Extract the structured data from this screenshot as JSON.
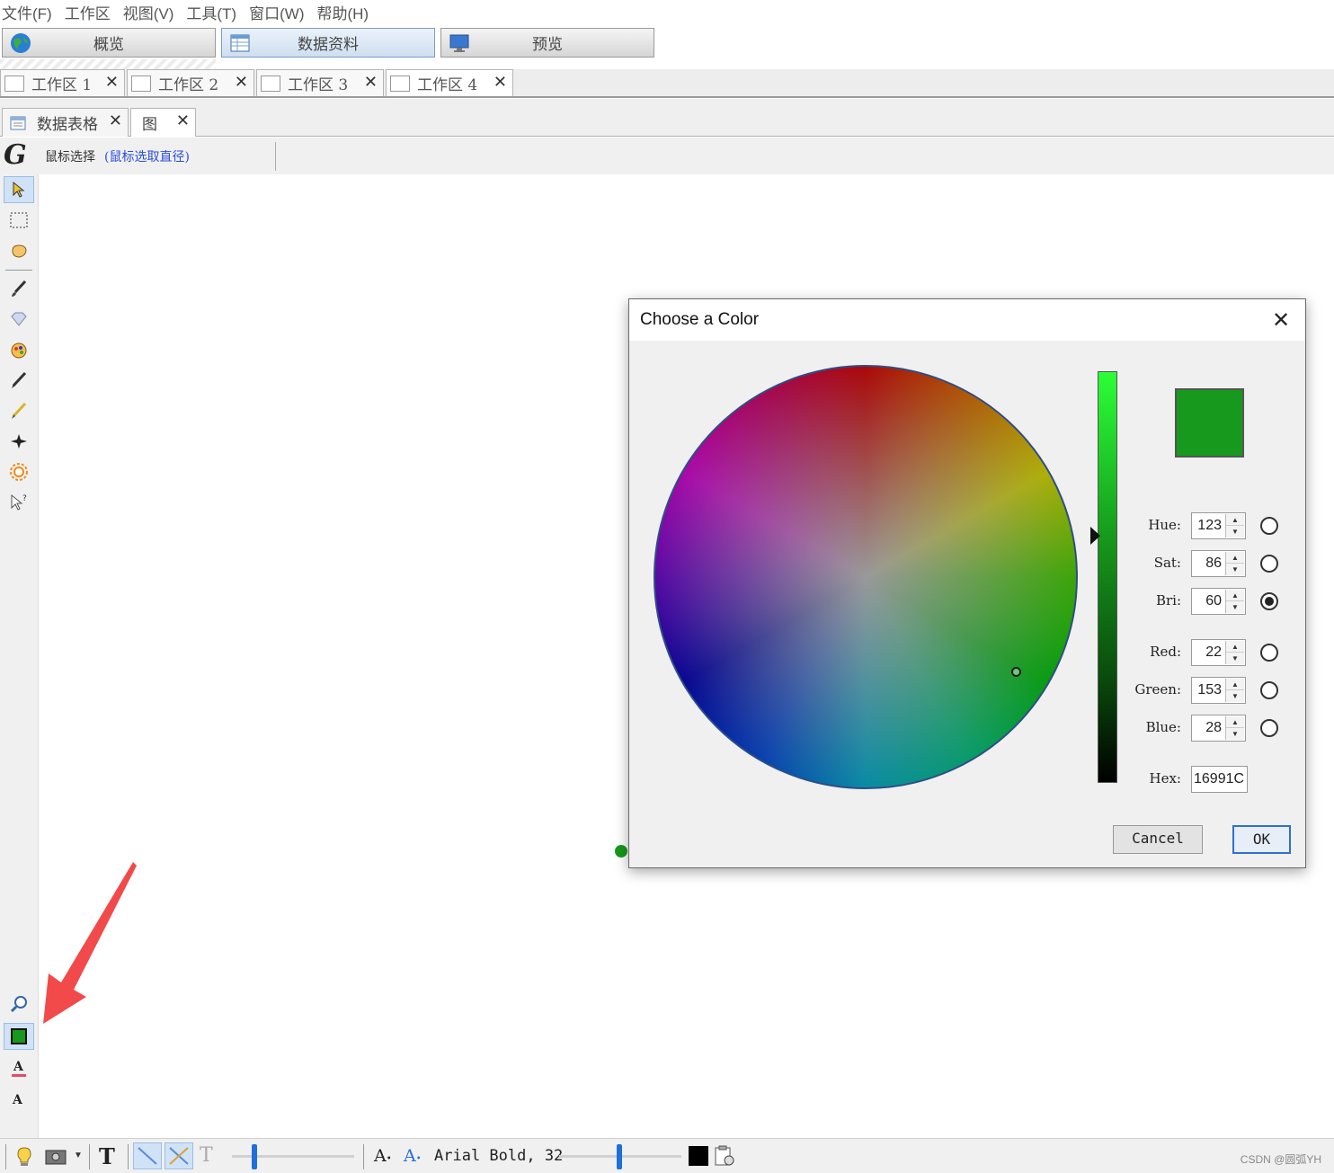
{
  "menu": [
    "文件(F)",
    "工作区",
    "视图(V)",
    "工具(T)",
    "窗口(W)",
    "帮助(H)"
  ],
  "nav": {
    "overview": "概览",
    "data": "数据资料",
    "preview": "预览"
  },
  "workspace_tabs": [
    "工作区 1",
    "工作区 2",
    "工作区 3",
    "工作区 4"
  ],
  "inner_tabs": [
    "数据表格",
    "图"
  ],
  "infobar": {
    "mode": "鼠标选择",
    "hint": "(鼠标选取直径)"
  },
  "bottom": {
    "font": "Arial Bold, 32",
    "credit": "CSDN @圆弧YH"
  },
  "dialog": {
    "title": "Choose a Color",
    "hue_label": "Hue:",
    "hue": "123",
    "sat_label": "Sat:",
    "sat": "86",
    "bri_label": "Bri:",
    "bri": "60",
    "red_label": "Red:",
    "red": "22",
    "green_label": "Green:",
    "green": "153",
    "blue_label": "Blue:",
    "blue": "28",
    "hex_label": "Hex:",
    "hex": "16991C",
    "cancel": "Cancel",
    "ok": "OK",
    "selected_radio": "Bri",
    "preview_color": "#16991C"
  },
  "colors": {
    "node_color": "#16991C",
    "accent": "#2d6fd4",
    "annotation_arrow": "#f24a4a"
  }
}
